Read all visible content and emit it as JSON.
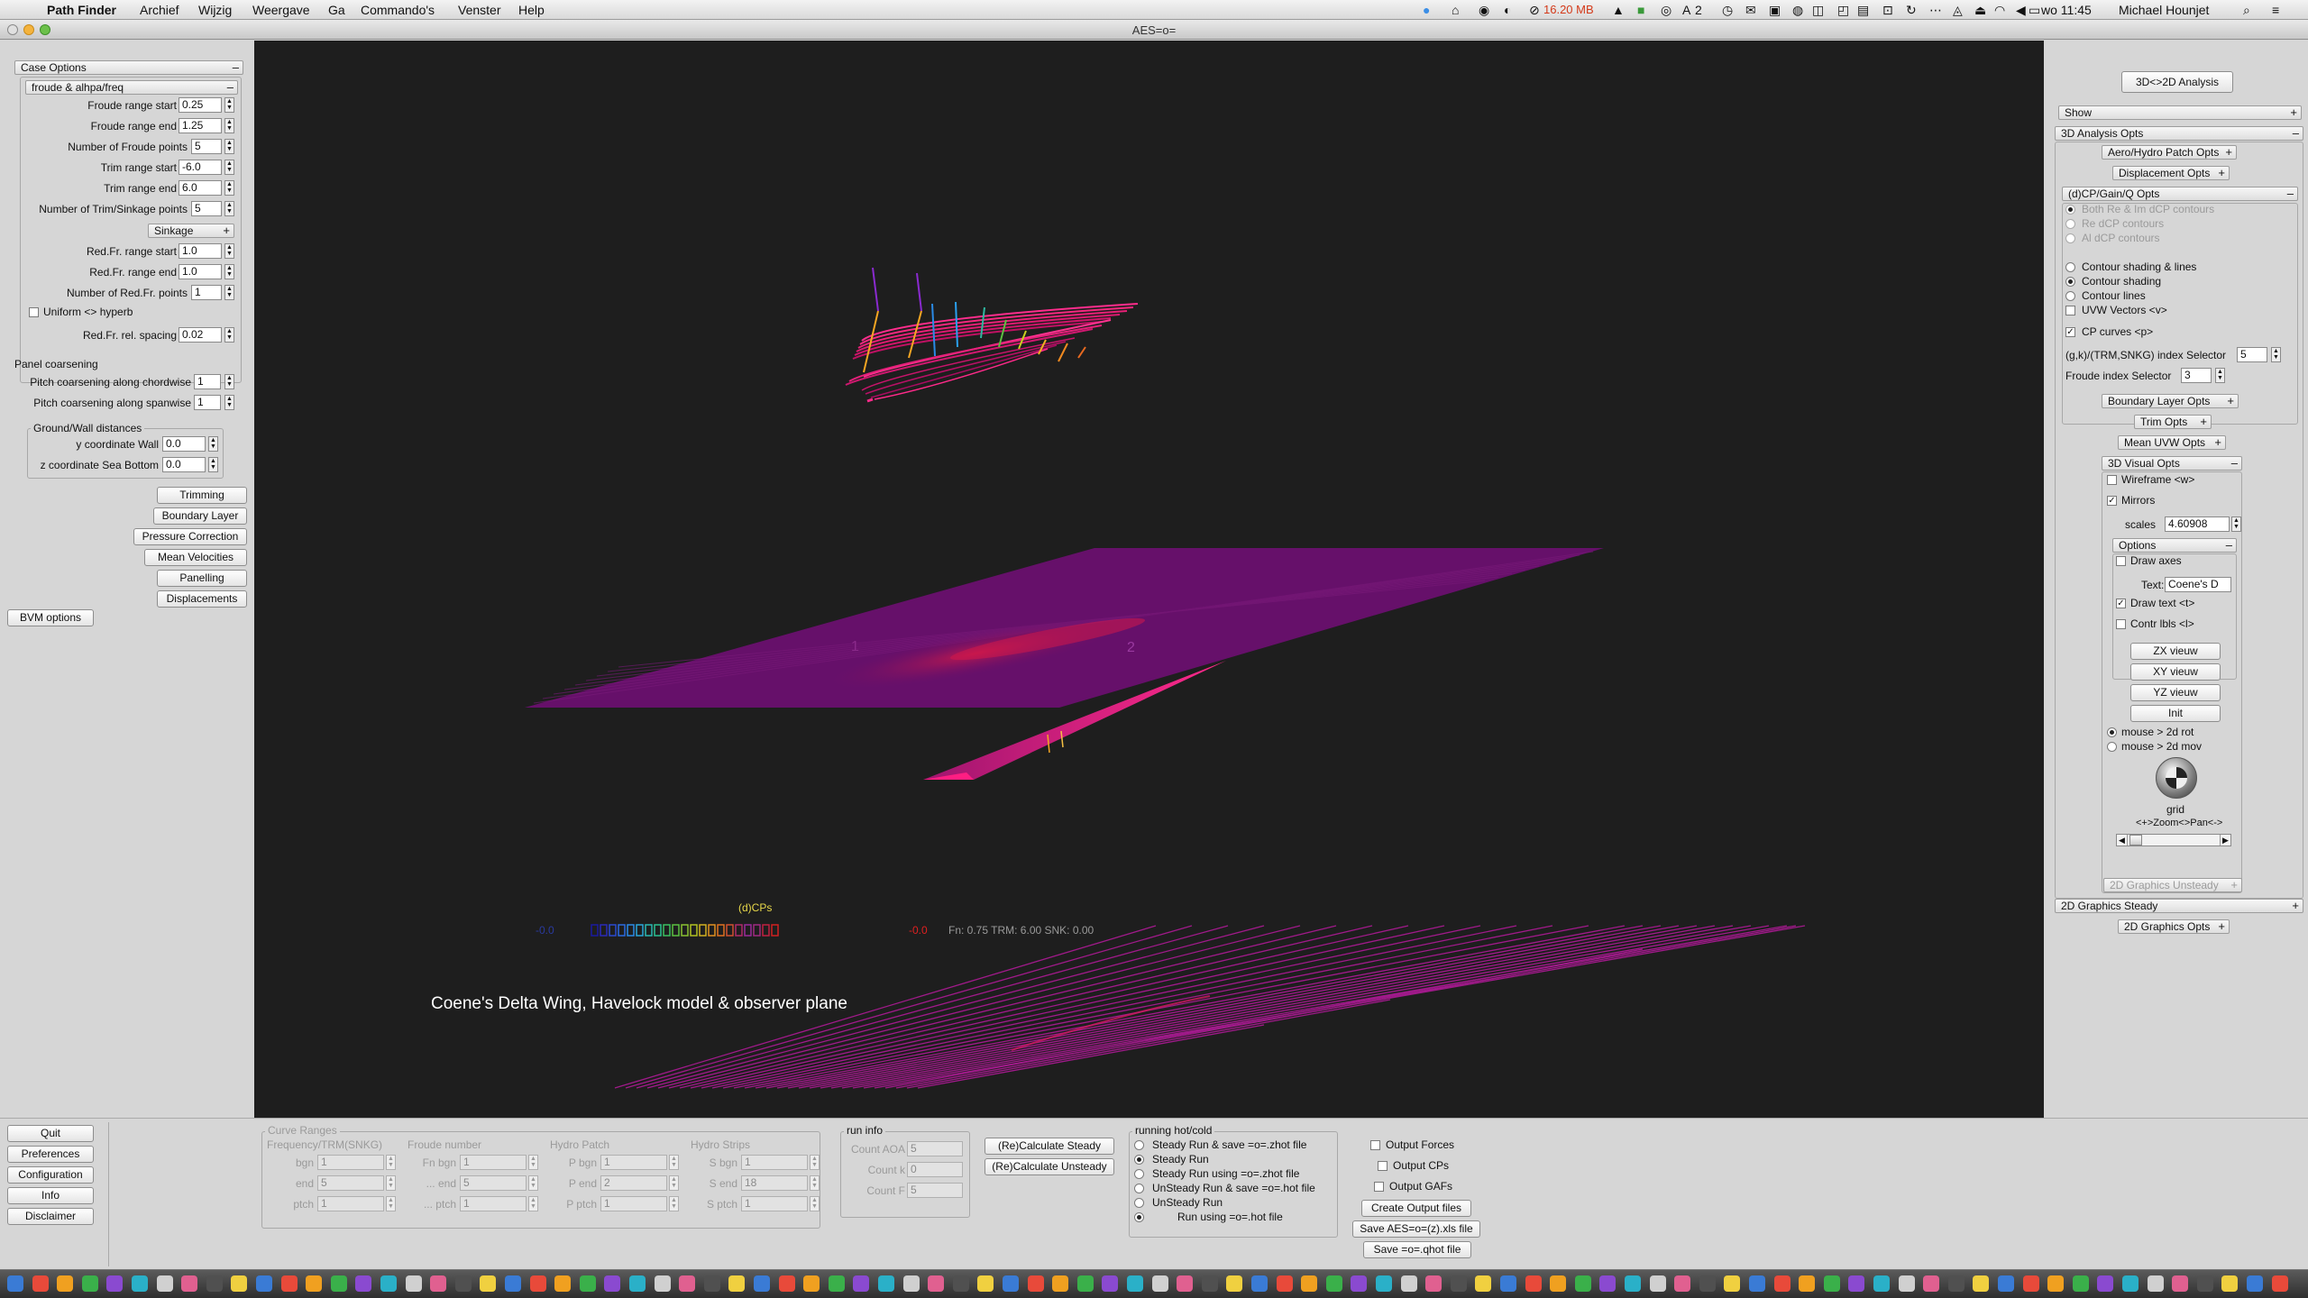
{
  "menubar": {
    "app_name": "Path Finder",
    "menus": [
      "Archief",
      "Wijzig",
      "Weergave",
      "Ga",
      "Commando's",
      "Venster",
      "Help"
    ],
    "memory": "16.20 MB",
    "badge_count": "2",
    "clock": "wo 11:45",
    "user": "Michael Hounjet"
  },
  "window": {
    "title": "AES=o="
  },
  "left": {
    "case_options": "Case Options",
    "froude_section": "froude & alhpa/freq",
    "froude_start_label": "Froude range start",
    "froude_start": "0.25",
    "froude_end_label": "Froude range end",
    "froude_end": "1.25",
    "froude_points_label": "Number of Froude points",
    "froude_points": "5",
    "trim_start_label": "Trim range start",
    "trim_start": "-6.0",
    "trim_end_label": "Trim range end",
    "trim_end": "6.0",
    "trim_points_label": "Number of Trim/Sinkage points",
    "trim_points": "5",
    "sinkage": "Sinkage",
    "redfr_start_label": "Red.Fr. range start",
    "redfr_start": "1.0",
    "redfr_end_label": "Red.Fr. range end",
    "redfr_end": "1.0",
    "redfr_points_label": "Number of Red.Fr. points",
    "redfr_points": "1",
    "uniform_label": "Uniform <> hyperb",
    "redfr_spacing_label": "Red.Fr. rel. spacing",
    "redfr_spacing": "0.02",
    "panel_coarsening": "Panel coarsening",
    "pitch_chord_label": "Pitch coarsening along chordwise",
    "pitch_chord": "1",
    "pitch_span_label": "Pitch coarsening along  spanwise",
    "pitch_span": "1",
    "ground_wall": "Ground/Wall distances",
    "y_wall_label": "y coordinate Wall",
    "y_wall": "0.0",
    "z_sea_label": "z coordinate Sea Bottom",
    "z_sea": "0.0",
    "buttons": [
      "Trimming",
      "Boundary Layer",
      "Pressure Correction",
      "Mean Velocities",
      "Panelling",
      "Displacements"
    ],
    "bvm": "BVM options"
  },
  "viewport": {
    "caption": "Coene's Delta Wing, Havelock model & observer plane",
    "legend_title": "(d)CPs",
    "legend_min": "-0.0",
    "legend_max": "-0.0",
    "status": "Fn: 0.75 TRM:   6.00 SNK:   0.00",
    "wing_label_1": "1",
    "wing_label_2": "2"
  },
  "right": {
    "analysis_toggle": "3D<>2D Analysis",
    "show": "Show",
    "analysis_opts": "3D Analysis Opts",
    "aero_hydro": "Aero/Hydro Patch Opts",
    "displacement": "Displacement  Opts",
    "dcp_opts": "(d)CP/Gain/Q  Opts",
    "both_re_im": "Both Re & Im dCP contours",
    "re_dcp": "Re dCP contours",
    "al_dcp": "Al dCP contours",
    "contour_shading_lines": "Contour shading & lines",
    "contour_shading": "Contour shading",
    "contour_lines": "Contour lines",
    "uvw_vectors": "UVW Vectors <v>",
    "cp_curves": "CP  curves  <p>",
    "index_selector_label": "(g,k)/(TRM,SNKG) index Selector",
    "index_selector": "5",
    "froude_index_label": "Froude index Selector",
    "froude_index": "3",
    "boundary_layer_opts": "Boundary Layer Opts",
    "trim_opts": "Trim  Opts",
    "mean_uvw_opts": "Mean UVW Opts",
    "visual_opts": "3D Visual Opts",
    "wireframe": "Wireframe <w>",
    "mirrors": "Mirrors",
    "scales_label": "scales",
    "scales": "4.60908",
    "options": "Options",
    "draw_axes": "Draw axes",
    "text_label": "Text:",
    "text_value": "Coene's D",
    "draw_text": "Draw  text <t>",
    "contr_lbls": "Contr lbls <l>",
    "views": [
      "ZX vieuw",
      "XY vieuw",
      "YZ vieuw",
      "Init"
    ],
    "mouse_rot": "mouse > 2d rot",
    "mouse_mov": "mouse > 2d mov",
    "grid": "grid",
    "zoom_pan": "<+>Zoom<>Pan<->",
    "graphics_unsteady": "2D Graphics Unsteady",
    "graphics_steady": "2D Graphics Steady",
    "graphics_opts": "2D Graphics Opts"
  },
  "bottom": {
    "side_buttons": [
      "Quit",
      "Preferences",
      "Configuration",
      "Info",
      "Disclaimer"
    ],
    "curve_ranges": "Curve Ranges",
    "col_headers": [
      "Frequency/TRM(SNKG)",
      "Froude number",
      "Hydro Patch",
      "Hydro Strips"
    ],
    "row1": [
      {
        "l": "bgn",
        "v": "1"
      },
      {
        "l": "Fn bgn",
        "v": "1"
      },
      {
        "l": "P bgn",
        "v": "1"
      },
      {
        "l": "S bgn",
        "v": "1"
      }
    ],
    "row2": [
      {
        "l": "end",
        "v": "5"
      },
      {
        "l": "... end",
        "v": "5"
      },
      {
        "l": "P end",
        "v": "2"
      },
      {
        "l": "S end",
        "v": "18"
      }
    ],
    "row3": [
      {
        "l": "ptch",
        "v": "1"
      },
      {
        "l": "... ptch",
        "v": "1"
      },
      {
        "l": "P ptch",
        "v": "1"
      },
      {
        "l": "S ptch",
        "v": "1"
      }
    ],
    "run_info": "run info",
    "count_aoa_label": "Count AOA",
    "count_aoa": "5",
    "count_k_label": "Count k",
    "count_k": "0",
    "count_f_label": "Count F",
    "count_f": "5",
    "recalc_steady": "(Re)Calculate Steady",
    "recalc_unsteady": "(Re)Calculate Unsteady",
    "running_hot_cold": "running hot/cold",
    "run_modes": [
      "Steady Run & save =o=.zhot file",
      "Steady Run",
      "Steady Run  using =o=.zhot file",
      "UnSteady Run & save =o=.hot file",
      "UnSteady Run",
      "Run  using =o=.hot file"
    ],
    "output_forces": "Output Forces",
    "output_cps": "Output CPs",
    "output_gafs": "Output GAFs",
    "create_output": "Create Output files",
    "save_xls": "Save AES=o=(z).xls file",
    "save_qhot": "Save =o=.qhot file"
  }
}
